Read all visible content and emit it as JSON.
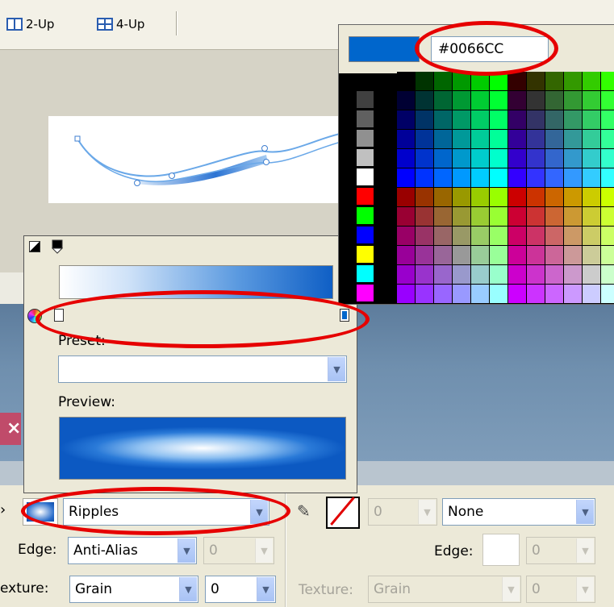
{
  "toolbar": {
    "two_up_label": "2-Up",
    "four_up_label": "4-Up"
  },
  "color_popup": {
    "hex_value": "#0066CC",
    "current_color": "#0066CC",
    "grays": [
      "#404040",
      "#606060",
      "#909090",
      "#c0c0c0",
      "#ffffff"
    ],
    "basics": [
      "#ff0000",
      "#00ff00",
      "#0000ff",
      "#ffff00",
      "#00ffff",
      "#ff00ff"
    ]
  },
  "gradient_editor": {
    "preset_label": "Preset:",
    "preset_value": "",
    "preview_label": "Preview:",
    "left_stop_color": "#ffffff",
    "right_stop_color": "#0066cc"
  },
  "properties": {
    "fill_type": "Ripples",
    "edge_label": "Edge:",
    "edge_value": "Anti-Alias",
    "feather_value": "0",
    "texture_label": "exture:",
    "texture_value": "Grain",
    "texture_amount": "0",
    "stroke_size": "0",
    "stroke_type": "None",
    "stroke_edge_label": "Edge:",
    "stroke_edge_value": "0",
    "stroke_texture_label": "Texture:",
    "stroke_texture_value": "Grain",
    "stroke_texture_amount": "0"
  },
  "accent_colors": {
    "selection_blue": "#0066CC",
    "annotation_red": "#e60000"
  }
}
